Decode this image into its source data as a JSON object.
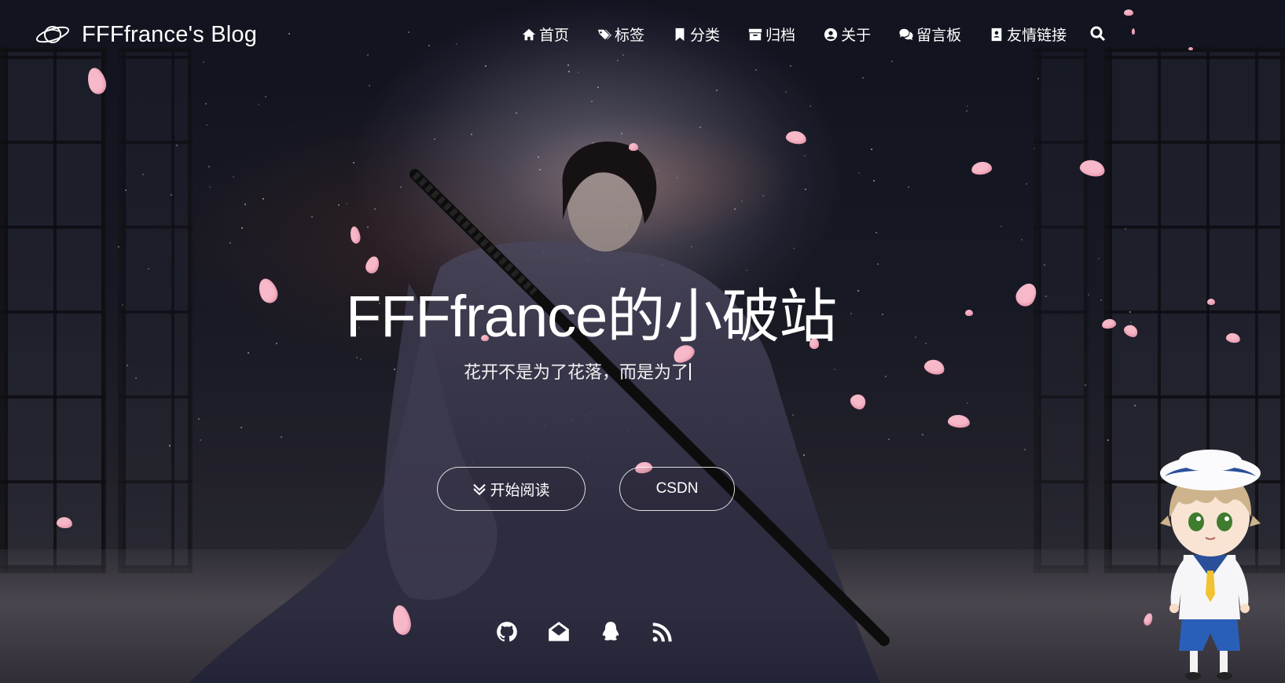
{
  "brand": {
    "title": "FFFfrance's Blog",
    "logo_icon": "planet-icon"
  },
  "nav": {
    "items": [
      {
        "label": "首页",
        "icon": "home-icon"
      },
      {
        "label": "标签",
        "icon": "tags-icon"
      },
      {
        "label": "分类",
        "icon": "bookmark-icon"
      },
      {
        "label": "归档",
        "icon": "archive-icon"
      },
      {
        "label": "关于",
        "icon": "user-circle-icon"
      },
      {
        "label": "留言板",
        "icon": "comments-icon"
      },
      {
        "label": "友情链接",
        "icon": "address-card-icon"
      }
    ],
    "search_icon": "search-icon"
  },
  "hero": {
    "title": "FFFfrance的小破站",
    "subtitle": "花开不是为了花落，而是为了"
  },
  "buttons": {
    "start_reading": "开始阅读",
    "csdn": "CSDN"
  },
  "social": [
    "github-icon",
    "envelope-open-icon",
    "qq-icon",
    "rss-icon"
  ],
  "colors": {
    "petal": "#f7b9c9",
    "text": "#ffffff"
  }
}
